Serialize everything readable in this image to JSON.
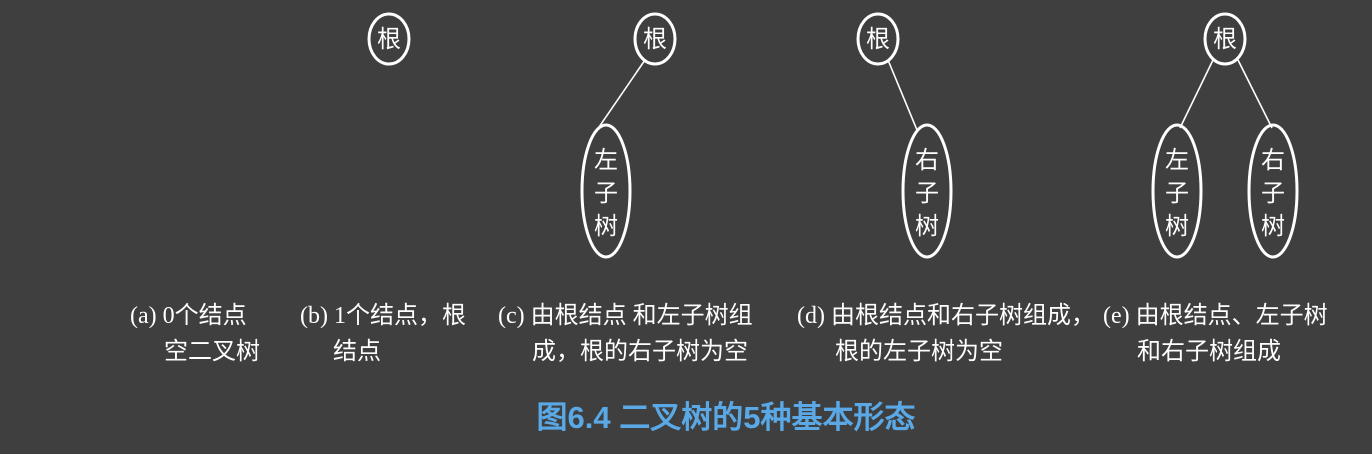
{
  "node_labels": {
    "root": "根",
    "left_subtree": [
      "左",
      "子",
      "树"
    ],
    "right_subtree": [
      "右",
      "子",
      "树"
    ]
  },
  "captions": [
    {
      "id": "a",
      "lines": [
        "(a) 0个结点",
        "空二叉树"
      ]
    },
    {
      "id": "b",
      "lines": [
        "(b) 1个结点，根",
        "结点"
      ]
    },
    {
      "id": "c",
      "lines": [
        "(c) 由根结点 和左子树组",
        "成，根的右子树为空"
      ]
    },
    {
      "id": "d",
      "lines": [
        "(d) 由根结点和右子树组成，",
        "根的左子树为空"
      ]
    },
    {
      "id": "e",
      "lines": [
        "(e) 由根结点、左子树",
        "和右子树组成"
      ]
    }
  ],
  "figure_title": "图6.4 二叉树的5种基本形态",
  "colors": {
    "background": "#3f3f3f",
    "stroke": "#ffffff",
    "title": "#5aa9e6"
  }
}
